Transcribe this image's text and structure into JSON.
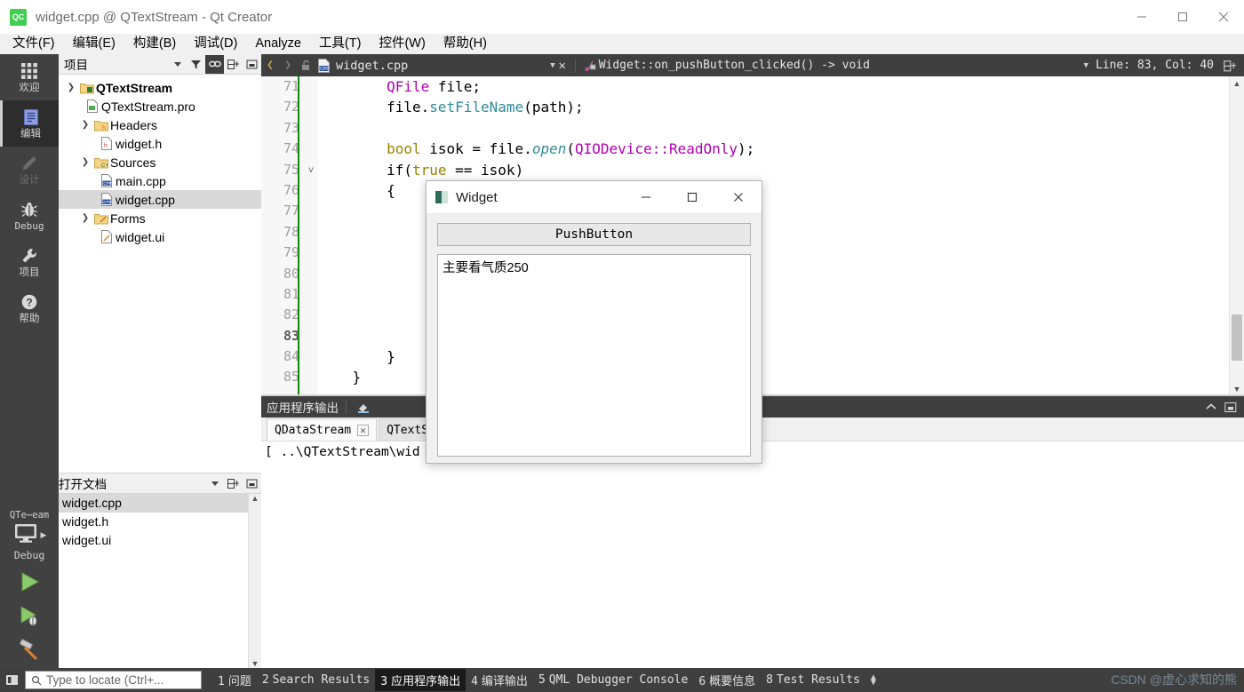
{
  "window": {
    "title": "widget.cpp @ QTextStream - Qt Creator",
    "logo_text": "QC",
    "controls": {
      "minimize": "minimize-icon",
      "maximize": "maximize-icon",
      "close": "close-icon"
    }
  },
  "menubar": {
    "items": [
      {
        "label": "文件(F)"
      },
      {
        "label": "编辑(E)"
      },
      {
        "label": "构建(B)"
      },
      {
        "label": "调试(D)"
      },
      {
        "label": "Analyze"
      },
      {
        "label": "工具(T)"
      },
      {
        "label": "控件(W)"
      },
      {
        "label": "帮助(H)"
      }
    ]
  },
  "modebar": {
    "items": [
      {
        "label": "欢迎",
        "icon": "grid-icon",
        "active": false,
        "dim": false
      },
      {
        "label": "编辑",
        "icon": "document-icon",
        "active": true,
        "dim": false
      },
      {
        "label": "设计",
        "icon": "pencil-icon",
        "active": false,
        "dim": true
      },
      {
        "label": "Debug",
        "icon": "bug-icon",
        "active": false,
        "dim": false
      },
      {
        "label": "项目",
        "icon": "wrench-icon",
        "active": false,
        "dim": false
      },
      {
        "label": "帮助",
        "icon": "question-circle-icon",
        "active": false,
        "dim": false
      }
    ],
    "kit": {
      "name": "QTe⋯eam",
      "build_mode": "Debug",
      "desktop_icon": "monitor-icon",
      "run_icon": "run-triangle-icon",
      "debug_icon": "debug-triangle-icon",
      "build_icon": "hammer-icon"
    }
  },
  "sidebar": {
    "project_header": {
      "title": "项目",
      "dropdown": "chevron-down-icon",
      "tools": [
        "filter-icon",
        "link-icon",
        "split-add-icon",
        "close-pane-icon"
      ]
    },
    "tree": [
      {
        "indent": 0,
        "twisty": "v",
        "icon": "project-folder-icon",
        "label": "QTextStream",
        "bold": true,
        "selected": false
      },
      {
        "indent": 1,
        "twisty": "",
        "icon": "pro-file-icon",
        "label": "QTextStream.pro",
        "bold": false,
        "selected": false
      },
      {
        "indent": 1,
        "twisty": "v",
        "icon": "headers-folder-icon",
        "label": "Headers",
        "bold": false,
        "selected": false
      },
      {
        "indent": 2,
        "twisty": "",
        "icon": "header-file-icon",
        "label": "widget.h",
        "bold": false,
        "selected": false
      },
      {
        "indent": 1,
        "twisty": "v",
        "icon": "sources-folder-icon",
        "label": "Sources",
        "bold": false,
        "selected": false
      },
      {
        "indent": 2,
        "twisty": "",
        "icon": "cpp-file-icon",
        "label": "main.cpp",
        "bold": false,
        "selected": false
      },
      {
        "indent": 2,
        "twisty": "",
        "icon": "cpp-file-icon",
        "label": "widget.cpp",
        "bold": false,
        "selected": true
      },
      {
        "indent": 1,
        "twisty": "v",
        "icon": "forms-folder-icon",
        "label": "Forms",
        "bold": false,
        "selected": false
      },
      {
        "indent": 2,
        "twisty": "",
        "icon": "ui-file-icon",
        "label": "widget.ui",
        "bold": false,
        "selected": false
      }
    ],
    "opendocs_header": {
      "title": "打开文档",
      "dropdown": "chevron-down-icon"
    },
    "opendocs": [
      {
        "label": "widget.cpp",
        "selected": true
      },
      {
        "label": "widget.h",
        "selected": false
      },
      {
        "label": "widget.ui",
        "selected": false
      }
    ]
  },
  "editor_toolbar": {
    "back_icon": "chevron-left-icon",
    "forward_icon": "chevron-right-icon",
    "lock_icon": "unlock-icon",
    "file_icon": "cpp-file-icon",
    "filename": "widget.cpp",
    "dropdown": "chevron-down-icon",
    "close_label": "✕",
    "symbol_icon": "function-icon",
    "symbol": "Widget::on_pushButton_clicked() -> void",
    "symbol_dropdown": "chevron-down-icon",
    "position": "Line: 83, Col: 40",
    "split_icon": "split-add-icon"
  },
  "code": {
    "lines": [
      {
        "num": "71",
        "fold": "",
        "current": false,
        "tokens": [
          {
            "t": "        ",
            "c": "k-punc"
          },
          {
            "t": "QFile",
            "c": "k-type"
          },
          {
            "t": " file;",
            "c": "k-punc"
          }
        ]
      },
      {
        "num": "72",
        "fold": "",
        "current": false,
        "tokens": [
          {
            "t": "        file.",
            "c": "k-punc"
          },
          {
            "t": "setFileName",
            "c": "k-fn"
          },
          {
            "t": "(path);",
            "c": "k-punc"
          }
        ]
      },
      {
        "num": "73",
        "fold": "",
        "current": false,
        "tokens": [
          {
            "t": "",
            "c": "k-punc"
          }
        ]
      },
      {
        "num": "74",
        "fold": "",
        "current": false,
        "tokens": [
          {
            "t": "        ",
            "c": "k-punc"
          },
          {
            "t": "bool",
            "c": "k-kw"
          },
          {
            "t": " isok = file.",
            "c": "k-punc"
          },
          {
            "t": "open",
            "c": "k-fni"
          },
          {
            "t": "(",
            "c": "k-punc"
          },
          {
            "t": "QIODevice::ReadOnly",
            "c": "k-type"
          },
          {
            "t": ");",
            "c": "k-punc"
          }
        ]
      },
      {
        "num": "75",
        "fold": "v",
        "current": false,
        "tokens": [
          {
            "t": "        if(",
            "c": "k-punc"
          },
          {
            "t": "true",
            "c": "k-kw"
          },
          {
            "t": " == isok)",
            "c": "k-punc"
          }
        ]
      },
      {
        "num": "76",
        "fold": "",
        "current": false,
        "tokens": [
          {
            "t": "        {",
            "c": "k-punc"
          }
        ]
      },
      {
        "num": "77",
        "fold": "",
        "current": false,
        "tokens": [
          {
            "t": "",
            "c": "k-punc"
          }
        ]
      },
      {
        "num": "78",
        "fold": "",
        "current": false,
        "tokens": [
          {
            "t": "",
            "c": "k-punc"
          }
        ]
      },
      {
        "num": "79",
        "fold": "",
        "current": false,
        "tokens": [
          {
            "t": "",
            "c": "k-punc"
          }
        ]
      },
      {
        "num": "80",
        "fold": "",
        "current": false,
        "tokens": [
          {
            "t": "",
            "c": "k-punc"
          }
        ]
      },
      {
        "num": "81",
        "fold": "",
        "current": false,
        "tokens": [
          {
            "t": "",
            "c": "k-punc"
          }
        ]
      },
      {
        "num": "82",
        "fold": "",
        "current": false,
        "tokens": [
          {
            "t": "",
            "c": "k-punc"
          }
        ]
      },
      {
        "num": "83",
        "fold": "",
        "current": true,
        "tokens": [
          {
            "t": "",
            "c": "k-punc"
          }
        ]
      },
      {
        "num": "84",
        "fold": "",
        "current": false,
        "tokens": [
          {
            "t": "        }",
            "c": "k-punc"
          }
        ]
      },
      {
        "num": "85",
        "fold": "",
        "current": false,
        "tokens": [
          {
            "t": "    }",
            "c": "k-punc"
          }
        ]
      }
    ]
  },
  "output": {
    "header_title": "应用程序输出",
    "header_icons": [
      "clear-output-icon",
      "chevron-up-icon",
      "minimize-pane-icon"
    ],
    "tabs": [
      {
        "label": "QDataStream",
        "active": true,
        "closable": true
      },
      {
        "label": "QTextStream",
        "active": false,
        "closable": true
      }
    ],
    "body": "[ ..\\QTextStream\\wid"
  },
  "dialog": {
    "title": "Widget",
    "app_icon": "widget-app-icon",
    "controls": {
      "minimize": "minimize-icon",
      "maximize": "maximize-icon",
      "close": "close-icon"
    },
    "button_label": "PushButton",
    "text_content": "主要看气质250"
  },
  "statusbar": {
    "sidebar_toggle": "sidebar-toggle-icon",
    "search_icon": "search-icon",
    "search_placeholder": "Type to locate (Ctrl+...",
    "items": [
      {
        "num": "1",
        "label": "问题",
        "active": false
      },
      {
        "num": "2",
        "label": "Search Results",
        "active": false
      },
      {
        "num": "3",
        "label": "应用程序输出",
        "active": true
      },
      {
        "num": "4",
        "label": "编译输出",
        "active": false
      },
      {
        "num": "5",
        "label": "QML Debugger Console",
        "active": false
      },
      {
        "num": "6",
        "label": "概要信息",
        "active": false
      },
      {
        "num": "8",
        "label": "Test Results",
        "active": false
      }
    ],
    "watermark": "CSDN @虚心求知的熊"
  },
  "colors": {
    "chrome_dark": "#3f3f3f",
    "modebar": "#414141",
    "active_mode": "#2d2d2d",
    "selection": "#d9d9d9",
    "qt_green": "#41cd52",
    "gutter_bar": "#0c8a0c"
  }
}
